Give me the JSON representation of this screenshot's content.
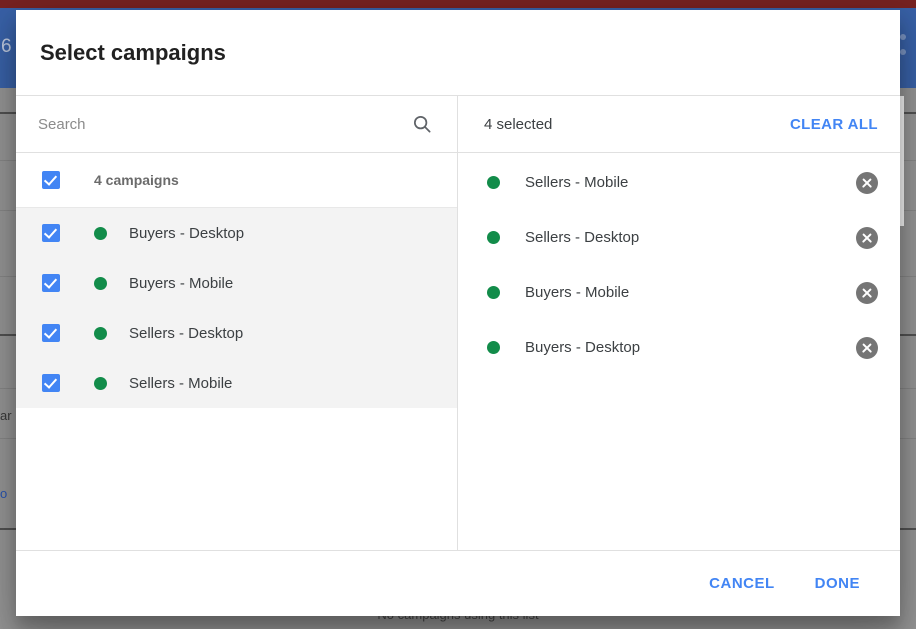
{
  "background": {
    "topbar_color": "#7b2423",
    "appbar_color": "#3b64ac",
    "partial_number": "6",
    "partial_left_text": "ar",
    "partial_left_text_2": "o",
    "bottom_text": "No campaigns using this list"
  },
  "dialog": {
    "title": "Select campaigns",
    "search": {
      "value": "",
      "placeholder": "Search",
      "icon": "search-icon"
    },
    "select_all": {
      "label": "4 campaigns",
      "checked": true
    },
    "campaigns": [
      {
        "label": "Buyers - Desktop",
        "checked": true,
        "status_color": "#128c4a"
      },
      {
        "label": "Buyers - Mobile",
        "checked": true,
        "status_color": "#128c4a"
      },
      {
        "label": "Sellers - Desktop",
        "checked": true,
        "status_color": "#128c4a"
      },
      {
        "label": "Sellers - Mobile",
        "checked": true,
        "status_color": "#128c4a"
      }
    ],
    "selected_panel": {
      "count_label": "4 selected",
      "clear_all_label": "CLEAR ALL",
      "items": [
        {
          "label": "Sellers - Mobile",
          "status_color": "#128c4a",
          "remove_icon": "close-circle-icon"
        },
        {
          "label": "Sellers - Desktop",
          "status_color": "#128c4a",
          "remove_icon": "close-circle-icon"
        },
        {
          "label": "Buyers - Mobile",
          "status_color": "#128c4a",
          "remove_icon": "close-circle-icon"
        },
        {
          "label": "Buyers - Desktop",
          "status_color": "#128c4a",
          "remove_icon": "close-circle-icon"
        }
      ]
    },
    "footer": {
      "cancel_label": "CANCEL",
      "done_label": "DONE"
    }
  },
  "colors": {
    "accent_blue": "#4285f4",
    "checkbox_blue": "#4285f4",
    "status_green": "#128c4a",
    "remove_gray": "#757575",
    "row_highlight": "#f3f3f3"
  }
}
